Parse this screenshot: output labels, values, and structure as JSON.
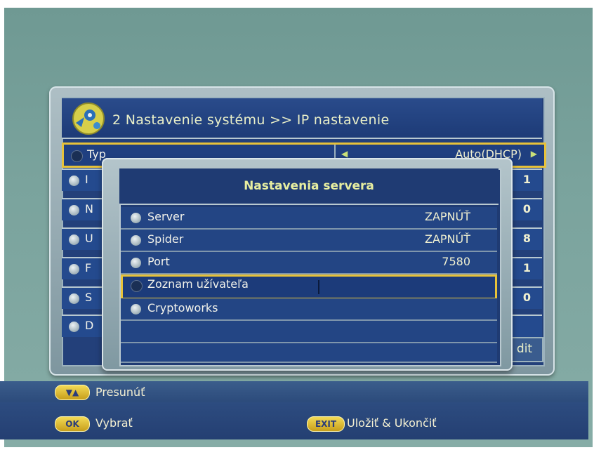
{
  "main": {
    "title": "2  Nastavenie systému >> IP nastavenie",
    "rows": [
      {
        "label": "Typ",
        "value": "Auto(DHCP)"
      },
      {
        "label": "I",
        "value": "1"
      },
      {
        "label": "N",
        "value": "0"
      },
      {
        "label": "U",
        "value": "8"
      },
      {
        "label": "F",
        "value": "1"
      },
      {
        "label": "S",
        "value": "0"
      },
      {
        "label": "D",
        "value": ""
      }
    ],
    "edit_fragment": "dit"
  },
  "popup": {
    "title": "Nastavenia servera",
    "rows": [
      {
        "label": "Server",
        "value": "ZAPNÚŤ"
      },
      {
        "label": "Spider",
        "value": "ZAPNÚŤ"
      },
      {
        "label": "Port",
        "value": "7580"
      },
      {
        "label": "Zoznam užívateľa",
        "value": ""
      },
      {
        "label": "Cryptoworks",
        "value": ""
      }
    ]
  },
  "footer": {
    "move_key": "▼▲",
    "move_label": "Presunúť",
    "ok_key": "OK",
    "ok_label": "Vybrať",
    "exit_key": "EXIT",
    "exit_label": "Uložiť & Ukončiť"
  }
}
